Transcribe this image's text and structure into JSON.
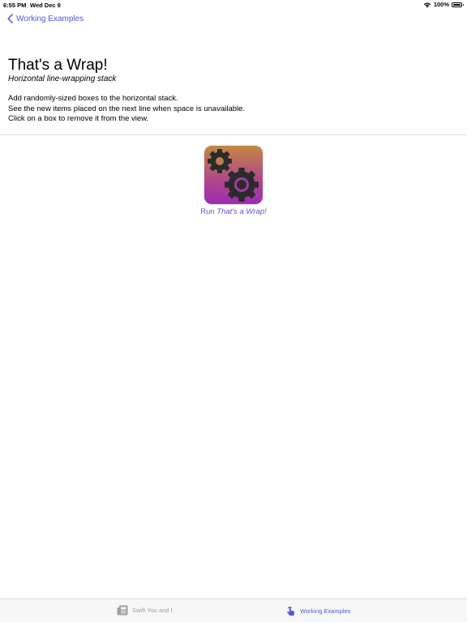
{
  "status_bar": {
    "time": "6:55 PM",
    "date": "Wed Dec 9",
    "battery": "100%",
    "battery_level": 1.0
  },
  "nav": {
    "back_label": "Working Examples"
  },
  "header": {
    "title": "That's a Wrap!",
    "subtitle": "Horizontal line-wrapping stack"
  },
  "description": [
    "Add randomly-sized boxes to the horizontal stack.",
    "See the new items placed on the next line when space is unavailable.",
    "Click on a box to remove it from the view."
  ],
  "run": {
    "prefix": "Run ",
    "name": "That's a Wrap!",
    "icon": "gears-icon"
  },
  "tabs": [
    {
      "label": "Swift You and I",
      "icon": "newspaper-icon",
      "selected": false
    },
    {
      "label": "Working Examples",
      "icon": "hand-tap-icon",
      "selected": true
    }
  ],
  "colors": {
    "accent": "#5856d6",
    "tab_inactive": "#a0a0a0",
    "icon_gradient_top": "#c38841",
    "icon_gradient_bottom": "#9e2bb3",
    "gear": "#2b2b2b"
  }
}
